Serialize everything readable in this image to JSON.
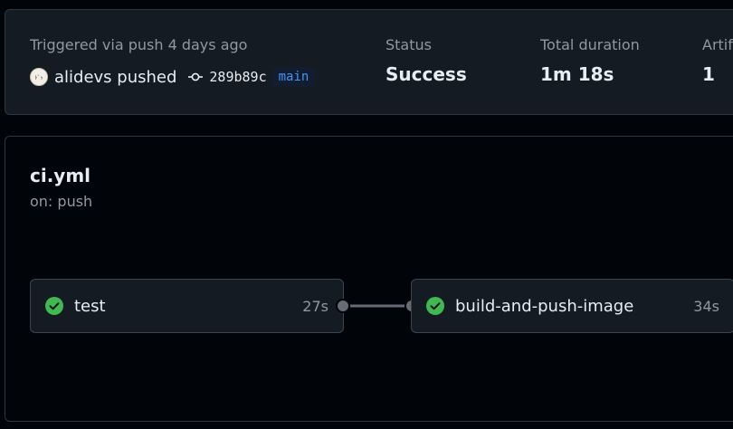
{
  "summary": {
    "trigger_text": "Triggered via push 4 days ago",
    "actor": "alidevs",
    "action": "pushed",
    "actor_line": "alidevs pushed",
    "commit_sha": "289b89c",
    "branch": "main",
    "status_label": "Status",
    "status_value": "Success",
    "duration_label": "Total duration",
    "duration_value": "1m 18s",
    "artifacts_label": "Artifacts",
    "artifacts_value": "1"
  },
  "workflow": {
    "name": "ci.yml",
    "trigger": "on: push",
    "jobs": [
      {
        "name": "test",
        "duration": "27s",
        "status": "success"
      },
      {
        "name": "build-and-push-image",
        "duration": "34s",
        "status": "success"
      }
    ]
  },
  "colors": {
    "success": "#3fb950",
    "branch": "#4493f8"
  },
  "icons": {
    "avatar": "avatar",
    "commit": "git-commit-icon",
    "check": "check-circle-fill-icon"
  }
}
